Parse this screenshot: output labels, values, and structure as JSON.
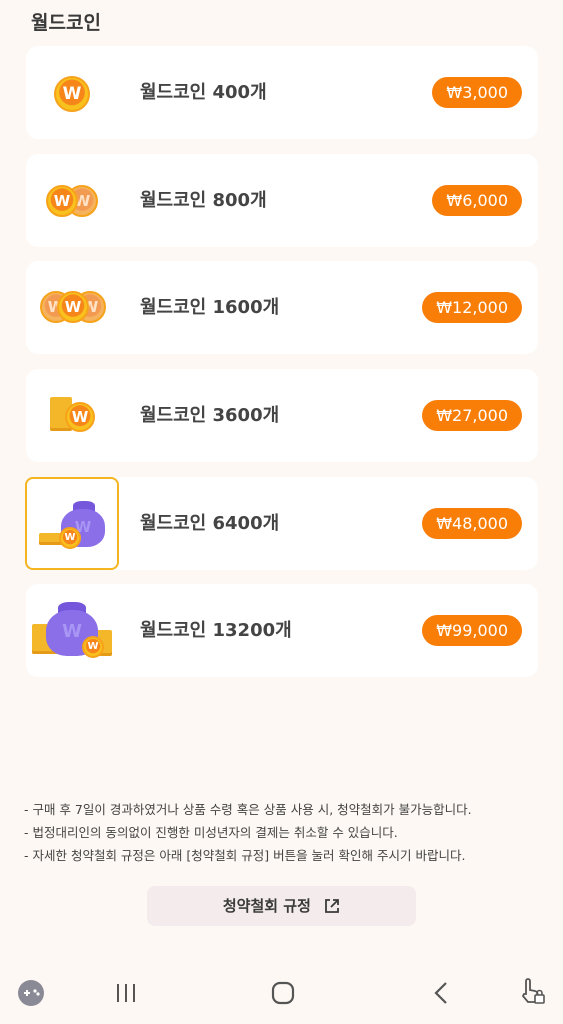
{
  "header": {
    "title": "월드코인"
  },
  "items": [
    {
      "label": "월드코인 400개",
      "price": "₩3,000",
      "icon": "single-coin-icon"
    },
    {
      "label": "월드코인 800개",
      "price": "₩6,000",
      "icon": "two-coins-icon"
    },
    {
      "label": "월드코인 1600개",
      "price": "₩12,000",
      "icon": "three-coins-icon"
    },
    {
      "label": "월드코인 3600개",
      "price": "₩27,000",
      "icon": "coin-stack-icon"
    },
    {
      "label": "월드코인 6400개",
      "price": "₩48,000",
      "icon": "coin-bag-icon",
      "selected": true
    },
    {
      "label": "월드코인 13200개",
      "price": "₩99,000",
      "icon": "coin-bag-large-icon"
    }
  ],
  "coin_glyph": "W",
  "notes": [
    "- 구매 후 7일이 경과하였거나 상품 수령 혹은 상품 사용 시, 청약철회가 불가능합니다.",
    "- 법정대리인의 동의없이 진행한 미성년자의 결제는 취소할 수 있습니다.",
    "- 자세한 청약철회 규정은 아래 [청약철회 규정] 버튼을 눌러 확인해 주시기 바랍니다."
  ],
  "policy_button": {
    "label": "청약철회 규정",
    "icon": "external-link-icon"
  },
  "navbar": {
    "icons": [
      "game-controller-icon",
      "recent-apps-icon",
      "home-icon",
      "back-icon",
      "touch-lock-icon"
    ]
  },
  "colors": {
    "accent": "#f97e08",
    "highlight": "#f5b520",
    "background": "#fdf8f3"
  }
}
